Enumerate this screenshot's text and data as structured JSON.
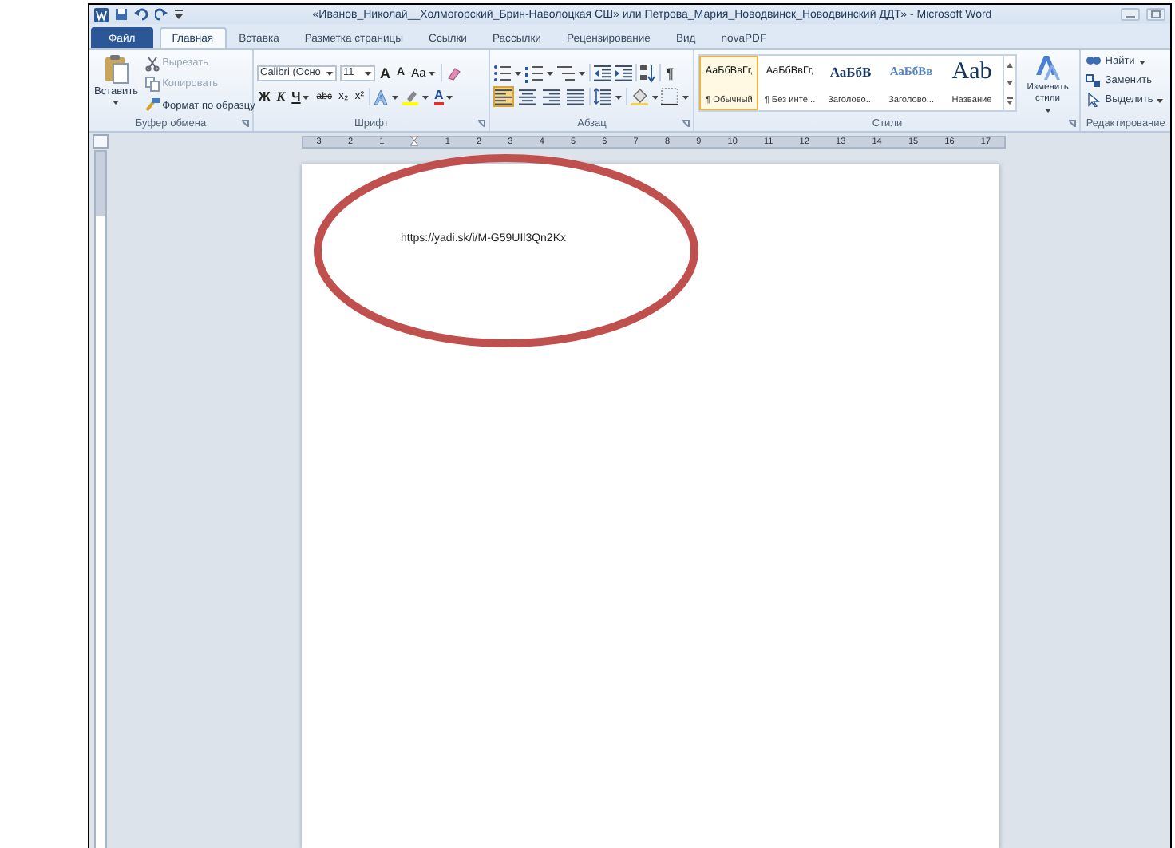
{
  "window": {
    "title": "«Иванов_Николай__Холмогорский_Брин-Наволоцкая СШ» или Петрова_Мария_Новодвинск_Новодвинский ДДТ» - Microsoft Word"
  },
  "tabs": [
    {
      "label": "Файл",
      "kind": "file",
      "selected": false
    },
    {
      "label": "Главная",
      "kind": "tab",
      "selected": true
    },
    {
      "label": "Вставка",
      "kind": "tab",
      "selected": false
    },
    {
      "label": "Разметка страницы",
      "kind": "tab",
      "selected": false
    },
    {
      "label": "Ссылки",
      "kind": "tab",
      "selected": false
    },
    {
      "label": "Рассылки",
      "kind": "tab",
      "selected": false
    },
    {
      "label": "Рецензирование",
      "kind": "tab",
      "selected": false
    },
    {
      "label": "Вид",
      "kind": "tab",
      "selected": false
    },
    {
      "label": "novaPDF",
      "kind": "tab",
      "selected": false
    }
  ],
  "ribbon": {
    "clipboard": {
      "paste": "Вставить",
      "items": [
        {
          "label": "Вырезать",
          "kind": "cut",
          "disabled": true
        },
        {
          "label": "Копировать",
          "kind": "copy",
          "disabled": true
        },
        {
          "label": "Формат по образцу",
          "kind": "painter",
          "disabled": false
        }
      ],
      "label": "Буфер обмена"
    },
    "font": {
      "name": "Calibri (Осно",
      "size": "11",
      "top_tools": [
        {
          "text": "A",
          "kind": "grow"
        },
        {
          "text": "A",
          "kind": "shrink"
        },
        {
          "text": "Aa",
          "kind": "case"
        }
      ],
      "bottom_tools": [
        {
          "text": "Ж",
          "kind": "bold"
        },
        {
          "text": "К",
          "kind": "italic"
        },
        {
          "text": "Ч",
          "kind": "underline"
        },
        {
          "text": "abc",
          "kind": "strike"
        },
        {
          "text": "x₂",
          "kind": "sub"
        },
        {
          "text": "x²",
          "kind": "sup"
        },
        {
          "text": "A",
          "kind": "color"
        }
      ],
      "label": "Шрифт"
    },
    "paragraph": {
      "pilcrow": "¶",
      "align_buttons": [
        {
          "selected": true
        },
        {
          "selected": false
        },
        {
          "selected": false
        },
        {
          "selected": false
        }
      ],
      "label": "Абзац"
    },
    "styles": {
      "items": [
        {
          "preview": "АаБбВвГг,",
          "name": "¶ Обычный",
          "kind": "normal",
          "selected": true
        },
        {
          "preview": "АаБбВвГг,",
          "name": "¶ Без инте...",
          "kind": "normal",
          "selected": false
        },
        {
          "preview": "АаБбВ",
          "name": "Заголово...",
          "kind": "heading1",
          "selected": false
        },
        {
          "preview": "АаБбВв",
          "name": "Заголово...",
          "kind": "heading2",
          "selected": false
        },
        {
          "preview": "Aab",
          "name": "Название",
          "kind": "title",
          "selected": false
        }
      ],
      "label": "Стили"
    },
    "change_styles": "Изменить стили",
    "editing": {
      "items": [
        {
          "label": "Найти",
          "kind": "find",
          "dropdown": true
        },
        {
          "label": "Заменить",
          "kind": "replace",
          "dropdown": false
        },
        {
          "label": "Выделить",
          "kind": "select",
          "dropdown": true
        }
      ],
      "label": "Редактирование"
    }
  },
  "ruler": {
    "left_labels": [
      "3",
      "2",
      "1"
    ],
    "labels": [
      "1",
      "2",
      "3",
      "4",
      "5",
      "6",
      "7",
      "8",
      "9",
      "10",
      "11",
      "12",
      "13",
      "14",
      "15",
      "16",
      "17"
    ]
  },
  "document": {
    "text": "https://yadi.sk/i/M-G59UIl3Qn2Kx"
  }
}
